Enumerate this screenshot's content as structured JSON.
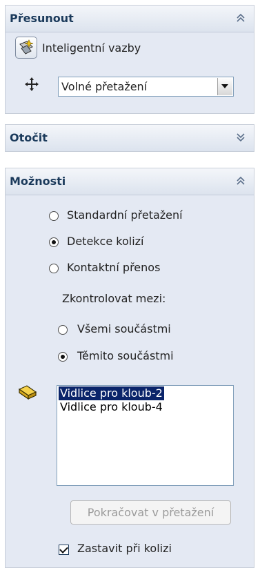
{
  "move_panel": {
    "title": "Přesunout",
    "smartmates_label": "Inteligentní vazby",
    "mode_value": "Volné přetažení"
  },
  "rotate_panel": {
    "title": "Otočit"
  },
  "options_panel": {
    "title": "Možnosti",
    "radios": [
      {
        "label": "Standardní přetažení",
        "selected": false
      },
      {
        "label": "Detekce kolizí",
        "selected": true
      },
      {
        "label": "Kontaktní přenos",
        "selected": false
      }
    ],
    "check_between_label": "Zkontrolovat mezi:",
    "between_options": [
      {
        "label": "Všemi součástmi",
        "selected": false
      },
      {
        "label": "Těmito součástmi",
        "selected": true
      }
    ],
    "components": [
      "Vidlice pro kloub-2",
      "Vidlice pro kloub-4"
    ],
    "selected_component_index": 0,
    "continue_button": "Pokračovat v přetažení",
    "stop_checkbox": {
      "label": "Zastavit při kolizi",
      "checked": true
    }
  }
}
